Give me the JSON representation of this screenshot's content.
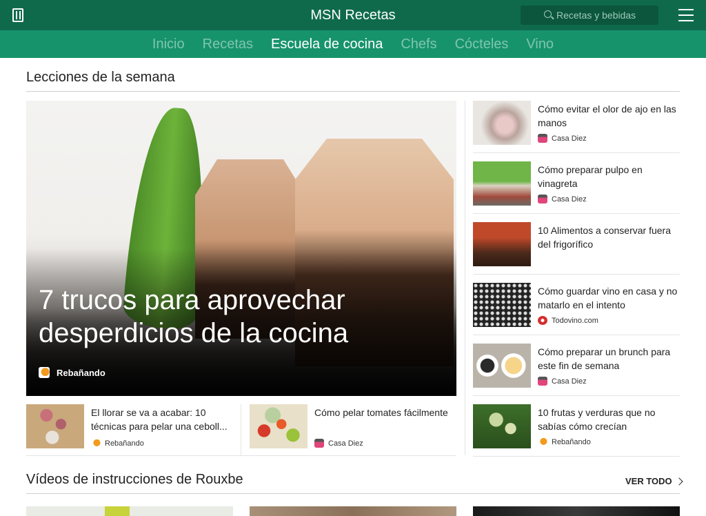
{
  "app": {
    "title": "MSN Recetas",
    "search_placeholder": "Recetas y bebidas"
  },
  "nav": [
    {
      "label": "Inicio"
    },
    {
      "label": "Recetas"
    },
    {
      "label": "Escuela de cocina",
      "active": true
    },
    {
      "label": "Chefs"
    },
    {
      "label": "Cócteles"
    },
    {
      "label": "Vino"
    }
  ],
  "lessons": {
    "title": "Lecciones de la semana",
    "hero": {
      "title": "7 trucos para aprovechar desperdicios de la cocina",
      "source": "Rebañando"
    },
    "side": [
      {
        "title": "Cómo evitar el olor de ajo en las manos",
        "source": "Casa Diez",
        "icon": "casa-diez-icon"
      },
      {
        "title": "Cómo preparar pulpo en vinagreta",
        "source": "Casa Diez",
        "icon": "casa-diez-icon"
      },
      {
        "title": "10 Alimentos a conservar fuera del frigorífico",
        "source": "",
        "icon": ""
      },
      {
        "title": "Cómo guardar vino en casa y no matarlo en el intento",
        "source": "Todovino.com",
        "icon": "todovino-icon"
      },
      {
        "title": "Cómo preparar un brunch para este fin de semana",
        "source": "Casa Diez",
        "icon": "casa-diez-icon"
      },
      {
        "title": "10 frutas y verduras que no sabías cómo crecían",
        "source": "Rebañando",
        "icon": "rebanando-icon"
      }
    ],
    "bottom": [
      {
        "title": "El llorar se va a acabar: 10 técnicas para pelar una ceboll...",
        "source": "Rebañando",
        "icon": "rebanando-icon"
      },
      {
        "title": "Cómo pelar tomates fácilmente",
        "source": "Casa Diez",
        "icon": "casa-diez-icon"
      }
    ]
  },
  "videos": {
    "title": "Vídeos de instrucciones de Rouxbe",
    "see_all": "VER TODO"
  },
  "colors": {
    "topbar": "#0f6a4c",
    "navbar": "#17936b",
    "nav_inactive": "#7fc6ad"
  }
}
